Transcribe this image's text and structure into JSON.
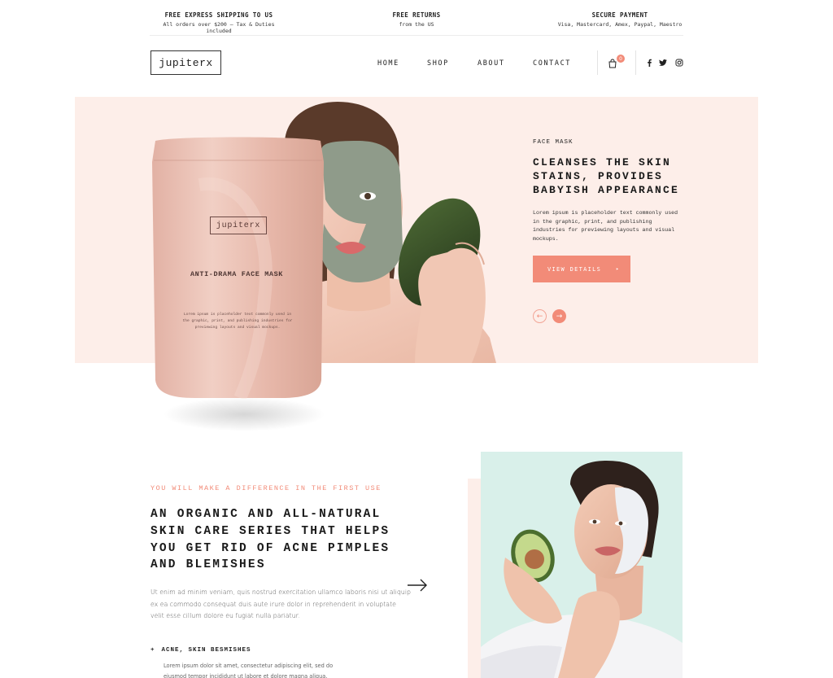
{
  "topbar": {
    "items": [
      {
        "title": "FREE EXPRESS SHIPPING TO US",
        "subtitle": "All orders over $200 — Tax & Duties included"
      },
      {
        "title": "FREE RETURNS",
        "subtitle": "from the US"
      },
      {
        "title": "SECURE PAYMENT",
        "subtitle": "Visa, Mastercard, Amex, Paypal, Maestro"
      }
    ]
  },
  "header": {
    "logo": "jupiterx",
    "nav": [
      "HOME",
      "SHOP",
      "ABOUT",
      "CONTACT"
    ],
    "cart_count": "0",
    "icons": [
      "bag-icon",
      "facebook-icon",
      "twitter-icon",
      "instagram-icon"
    ]
  },
  "hero": {
    "product": {
      "logo": "jupiterx",
      "title": "ANTI-DRAMA FACE MASK",
      "description": "Lorem ipsum is placeholder text commonly used in the graphic, print, and publishing industries for previewing layouts and visual mockups."
    },
    "eyebrow": "FACE MASK",
    "title": "CLEANSES THE SKIN STAINS, PROVIDES BABYISH APPEARANCE",
    "description": "Lorem ipsum is placeholder text commonly used in the graphic, print, and publishing industries for previewing layouts and visual mockups.",
    "button": "VIEW DETAILS",
    "button_arrow": "▸",
    "prev": "←",
    "next": "→"
  },
  "section2": {
    "eyebrow": "YOU WILL MAKE A DIFFERENCE IN THE FIRST USE",
    "title": "AN ORGANIC AND ALL-NATURAL SKIN CARE SERIES THAT HELPS YOU GET RID OF ACNE PIMPLES AND BLEMISHES",
    "paragraph": "Ut enim ad minim veniam, quis nostrud exercitation ullamco laboris nisi ut aliquip ex ea commodo consequat duis aute irure dolor in reprehenderit in voluptate velit esse cillum dolore eu fugiat nulla pariatur.",
    "feature": {
      "plus": "+",
      "title": "ACNE, SKIN BESMISHES",
      "description": "Lorem ipsum dolor sit amet, consectetur adipiscing elit, sed do eiusmod tempor incididunt ut labore et dolore magna aliqua."
    }
  },
  "colors": {
    "accent": "#f28b78",
    "hero_bg": "#fdeee9",
    "photo_bg": "#d9f0ea",
    "text": "#1a1a1a"
  }
}
